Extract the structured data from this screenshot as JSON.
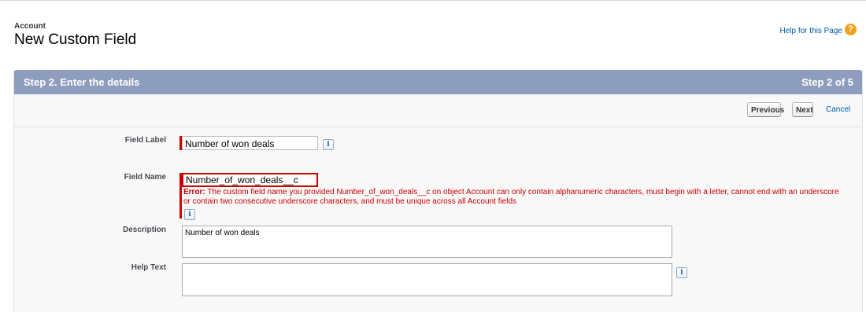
{
  "header": {
    "object_name": "Account",
    "title": "New Custom Field",
    "help_link": "Help for this Page",
    "help_icon": "help-question-icon"
  },
  "step": {
    "title": "Step 2. Enter the details",
    "counter": "Step 2 of 5"
  },
  "buttons": {
    "previous": "Previous",
    "next": "Next",
    "cancel": "Cancel"
  },
  "form": {
    "field_label": {
      "label": "Field Label",
      "value": "Number of won deals"
    },
    "field_name": {
      "label": "Field Name",
      "value": "Number_of_won_deals__c",
      "error_prefix": "Error:",
      "error_text": " The custom field name you provided Number_of_won_deals__c on object Account can only contain alphanumeric characters, must begin with a letter, cannot end with an underscore or contain two consecutive underscore characters, and must be unique across all Account fields"
    },
    "description": {
      "label": "Description",
      "value": "Number of won deals"
    },
    "help_text": {
      "label": "Help Text",
      "value": ""
    },
    "info_glyph": "i"
  },
  "colors": {
    "step_header": "#8e9dbe",
    "error": "#cc0000",
    "link": "#015ba7",
    "help_icon": "#f29f1c"
  }
}
